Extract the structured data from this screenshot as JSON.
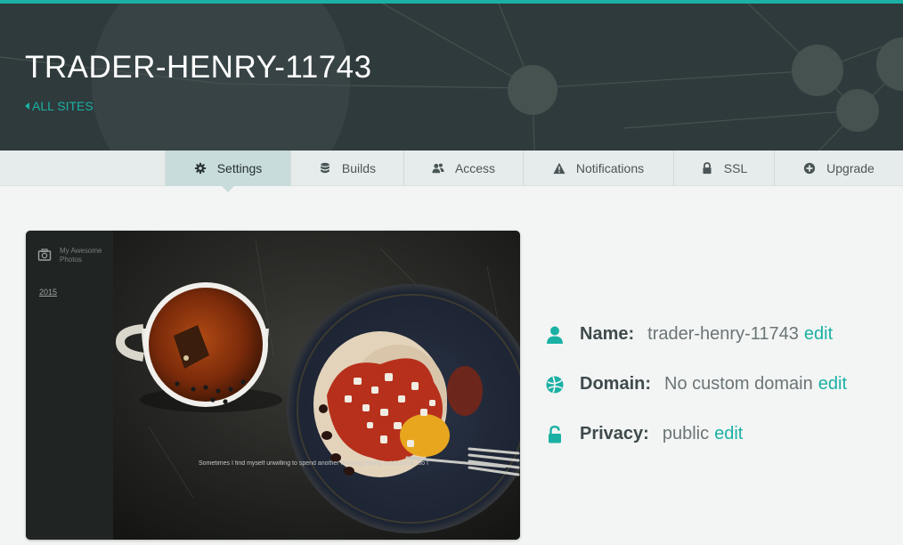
{
  "site": {
    "title": "TRADER-HENRY-11743",
    "all_sites_label": "ALL SITES"
  },
  "tabs": [
    {
      "label": "Settings",
      "icon": "gear-icon",
      "active": true
    },
    {
      "label": "Builds",
      "icon": "database-icon",
      "active": false
    },
    {
      "label": "Access",
      "icon": "users-icon",
      "active": false
    },
    {
      "label": "Notifications",
      "icon": "warning-icon",
      "active": false
    },
    {
      "label": "SSL",
      "icon": "lock-icon",
      "active": false
    },
    {
      "label": "Upgrade",
      "icon": "plus-circle-icon",
      "active": false
    }
  ],
  "preview": {
    "site_name": "My Awesome Photos",
    "year_link": "2015",
    "caption": "Sometimes I find myself unwilling to spend another morning eating cold cereal. So I made huevos ra"
  },
  "details": {
    "name_label": "Name:",
    "name_value": "trader-henry-11743",
    "domain_label": "Domain:",
    "domain_value": "No custom domain",
    "privacy_label": "Privacy:",
    "privacy_value": "public",
    "edit_label": "edit"
  },
  "colors": {
    "accent": "#1ab1a4",
    "header_bg": "#2f3a3c",
    "tabbar_bg": "#e6eceb",
    "active_tab_bg": "#c8dcdb",
    "page_bg": "#f3f5f4"
  }
}
